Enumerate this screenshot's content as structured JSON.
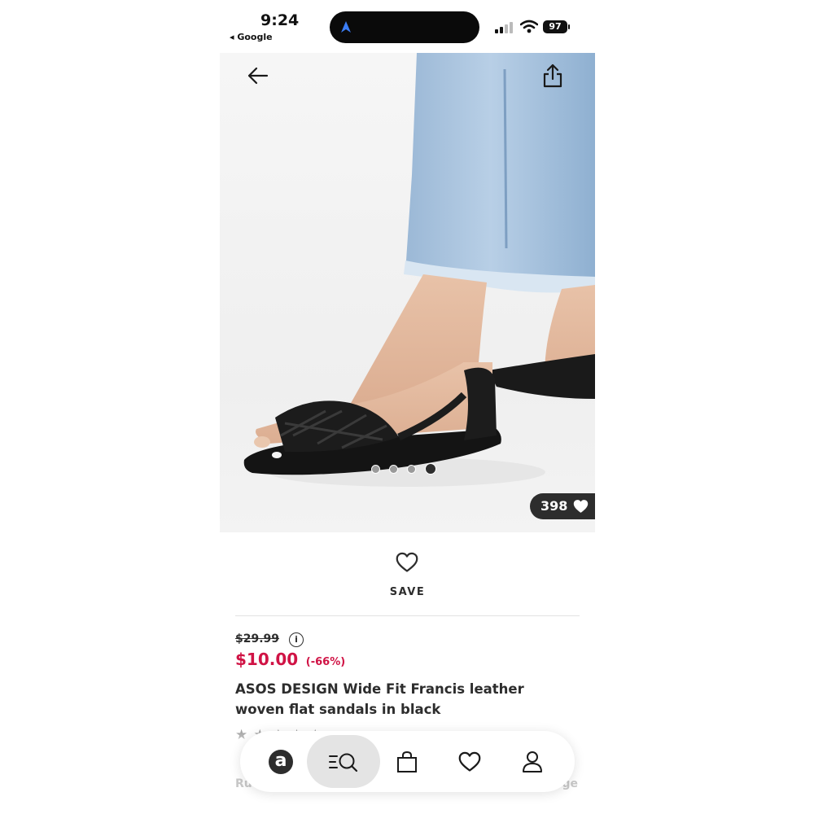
{
  "status_bar": {
    "time": "9:24",
    "back_app": "◂ Google",
    "battery": "97",
    "icons": [
      "location-arrow-icon",
      "signal-icon",
      "wifi-icon",
      "battery-icon"
    ]
  },
  "hero": {
    "image_alt": "Black woven flat sandal worn with light-wash jeans",
    "gallery_dots": 4,
    "active_dot": 4,
    "likes_count": "398",
    "icons": [
      "back-arrow-icon",
      "share-icon",
      "heart-filled-icon"
    ]
  },
  "save": {
    "label": "SAVE",
    "icon": "heart-outline-icon"
  },
  "product": {
    "old_price": "$29.99",
    "new_price": "$10.00",
    "discount": "(-66%)",
    "title": "ASOS DESIGN Wide Fit Francis leather woven flat sandals in black",
    "rating_stars": "★ ★ ★ ★ ★",
    "partial_row_left": "Ru",
    "partial_row_right": "ge"
  },
  "bottom_nav": {
    "items": [
      "asos-home-icon",
      "search-icon",
      "bag-icon",
      "saved-heart-icon",
      "account-icon"
    ],
    "logo_letter": "a"
  },
  "colors": {
    "sale_red": "#d01345",
    "dark": "#2d2d2d",
    "jeans_blue": "#a9c4df"
  }
}
